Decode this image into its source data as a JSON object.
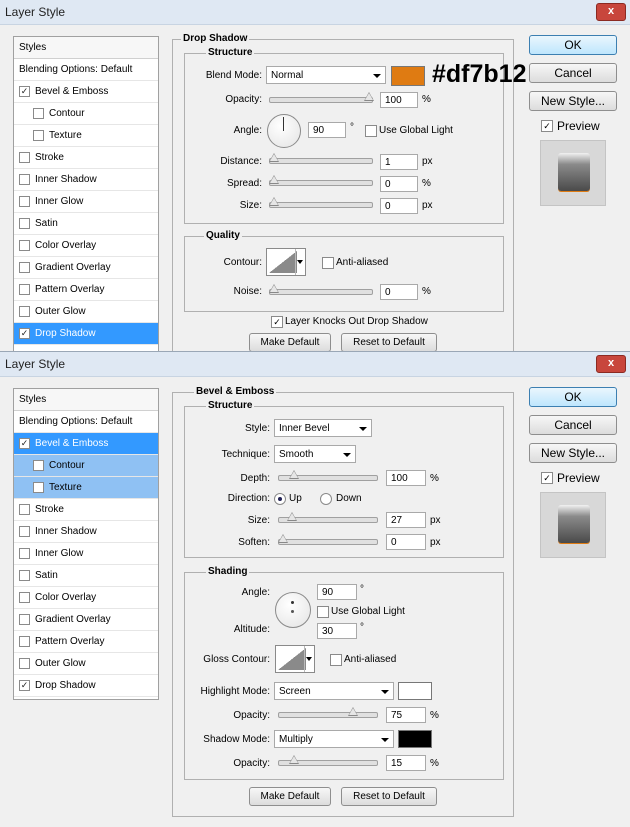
{
  "dialog1": {
    "title": "Layer Style",
    "close": "x",
    "styles_header": "Styles",
    "items": [
      {
        "label": "Blending Options: Default",
        "checkbox": null
      },
      {
        "label": "Bevel & Emboss",
        "checkbox": "✓"
      },
      {
        "label": "Contour",
        "checkbox": ""
      },
      {
        "label": "Texture",
        "checkbox": ""
      },
      {
        "label": "Stroke",
        "checkbox": ""
      },
      {
        "label": "Inner Shadow",
        "checkbox": ""
      },
      {
        "label": "Inner Glow",
        "checkbox": ""
      },
      {
        "label": "Satin",
        "checkbox": ""
      },
      {
        "label": "Color Overlay",
        "checkbox": ""
      },
      {
        "label": "Gradient Overlay",
        "checkbox": ""
      },
      {
        "label": "Pattern Overlay",
        "checkbox": ""
      },
      {
        "label": "Outer Glow",
        "checkbox": ""
      },
      {
        "label": "Drop Shadow",
        "checkbox": "✓"
      }
    ],
    "section_title": "Drop Shadow",
    "structure_title": "Structure",
    "blend_mode_label": "Blend Mode:",
    "blend_mode_value": "Normal",
    "swatch_color": "#df7b12",
    "hex_label": "#df7b12",
    "opacity_label": "Opacity:",
    "opacity_value": "100",
    "opacity_percent": 1.0,
    "pct": "%",
    "angle_label": "Angle:",
    "angle_value": "90",
    "degree": "°",
    "use_global_light": "Use Global Light",
    "distance_label": "Distance:",
    "distance_value": "1",
    "spread_label": "Spread:",
    "spread_value": "0",
    "size_label": "Size:",
    "size_value": "0",
    "px": "px",
    "quality_title": "Quality",
    "contour_label": "Contour:",
    "anti_aliased": "Anti-aliased",
    "noise_label": "Noise:",
    "noise_value": "0",
    "knockout": "Layer Knocks Out Drop Shadow",
    "knockout_check": "✓",
    "make_default": "Make Default",
    "reset_default": "Reset to Default",
    "ok": "OK",
    "cancel": "Cancel",
    "new_style": "New Style...",
    "preview": "Preview",
    "preview_check": "✓"
  },
  "dialog2": {
    "title": "Layer Style",
    "close": "x",
    "styles_header": "Styles",
    "items": [
      {
        "label": "Blending Options: Default",
        "checkbox": null
      },
      {
        "label": "Bevel & Emboss",
        "checkbox": "✓"
      },
      {
        "label": "Contour",
        "checkbox": ""
      },
      {
        "label": "Texture",
        "checkbox": ""
      },
      {
        "label": "Stroke",
        "checkbox": ""
      },
      {
        "label": "Inner Shadow",
        "checkbox": ""
      },
      {
        "label": "Inner Glow",
        "checkbox": ""
      },
      {
        "label": "Satin",
        "checkbox": ""
      },
      {
        "label": "Color Overlay",
        "checkbox": ""
      },
      {
        "label": "Gradient Overlay",
        "checkbox": ""
      },
      {
        "label": "Pattern Overlay",
        "checkbox": ""
      },
      {
        "label": "Outer Glow",
        "checkbox": ""
      },
      {
        "label": "Drop Shadow",
        "checkbox": "✓"
      }
    ],
    "section_title": "Bevel & Emboss",
    "structure_title": "Structure",
    "style_label": "Style:",
    "style_value": "Inner Bevel",
    "technique_label": "Technique:",
    "technique_value": "Smooth",
    "depth_label": "Depth:",
    "depth_value": "100",
    "direction_label": "Direction:",
    "up": "Up",
    "down": "Down",
    "size_label": "Size:",
    "size_value": "27",
    "soften_label": "Soften:",
    "soften_value": "0",
    "pct": "%",
    "px": "px",
    "shading_title": "Shading",
    "angle_label": "Angle:",
    "angle_value": "90",
    "degree": "°",
    "use_global_light": "Use Global Light",
    "altitude_label": "Altitude:",
    "altitude_value": "30",
    "gloss_contour_label": "Gloss Contour:",
    "anti_aliased": "Anti-aliased",
    "highlight_mode_label": "Highlight Mode:",
    "highlight_mode_value": "Screen",
    "highlight_color": "#ffffff",
    "highlight_opacity_label": "Opacity:",
    "highlight_opacity_value": "75",
    "shadow_mode_label": "Shadow Mode:",
    "shadow_mode_value": "Multiply",
    "shadow_color": "#000000",
    "shadow_opacity_label": "Opacity:",
    "shadow_opacity_value": "15",
    "make_default": "Make Default",
    "reset_default": "Reset to Default",
    "ok": "OK",
    "cancel": "Cancel",
    "new_style": "New Style...",
    "preview": "Preview",
    "preview_check": "✓"
  }
}
